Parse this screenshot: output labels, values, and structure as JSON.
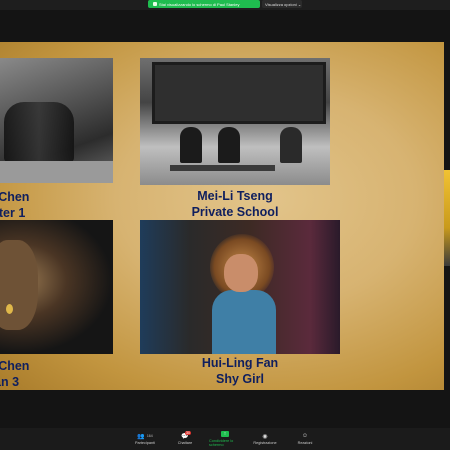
{
  "topbar": {
    "share_status": "Stai visualizzando lo schermo di Paul Stanley",
    "view_options": "Visualizza opzioni ⌄"
  },
  "slide": {
    "entries": [
      {
        "author": "…ang Chen",
        "title": "…y Sitter 1"
      },
      {
        "author": "Mei-Li Tseng",
        "title": "Private School"
      },
      {
        "author": "…ang Chen",
        "title": "…d Man 3"
      },
      {
        "author": "Hui-Ling Fan",
        "title": "Shy Girl"
      }
    ]
  },
  "toolbar": {
    "participants_label": "Partecipanti",
    "participants_count": "164",
    "chat_label": "Chattare",
    "chat_badge": "30",
    "share_label": "Condividere lo schermo",
    "record_label": "Registrazione",
    "reactions_label": "Reazioni"
  },
  "colors": {
    "accent_green": "#1fbd4f",
    "caption_blue": "#0f1f5e",
    "badge_red": "#e0342f"
  }
}
